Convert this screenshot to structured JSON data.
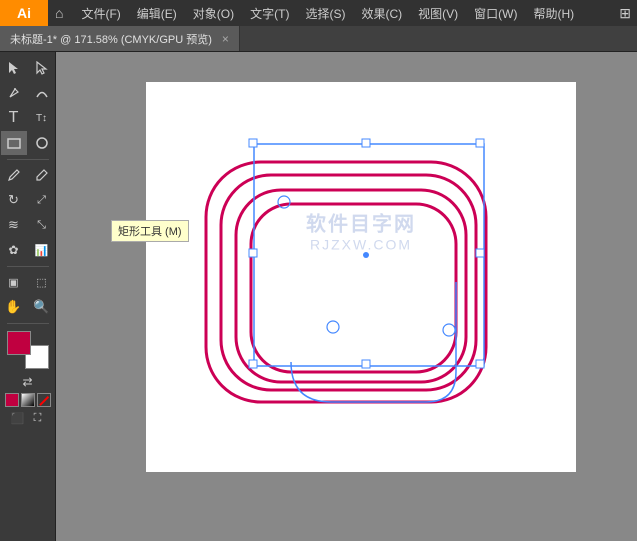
{
  "app": {
    "logo": "Ai",
    "logo_bg": "#FF8C00"
  },
  "menu": {
    "items": [
      "文件(F)",
      "编辑(E)",
      "对象(O)",
      "文字(T)",
      "选择(S)",
      "效果(C)",
      "视图(V)",
      "窗口(W)",
      "帮助(H)"
    ]
  },
  "tab": {
    "title": "未标题-1* @ 171.58% (CMYK/GPU 预览)",
    "close": "×"
  },
  "tooltip": {
    "text": "矩形工具 (M)"
  },
  "watermark": {
    "line1": "软件目字网",
    "line2": "RJZXW.COM"
  }
}
